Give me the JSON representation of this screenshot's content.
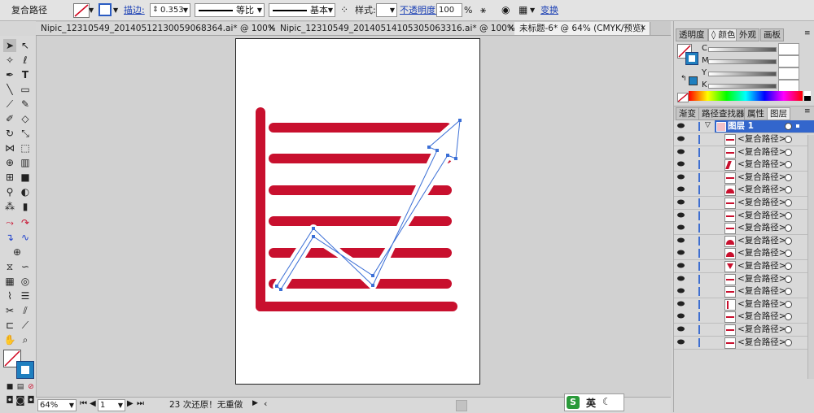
{
  "control_bar": {
    "selection_label": "复合路径",
    "stroke_label": "描边:",
    "stroke_value": "0.353",
    "profile_label": "等比",
    "brush_label": "基本",
    "style_label": "样式:",
    "opacity_label": "不透明度:",
    "opacity_value": "100",
    "opacity_unit": "%",
    "transform_label": "变换"
  },
  "tabs": [
    {
      "label": "Nipic_12310549_20140512130059068364.ai* @ 100% (R...",
      "close": "×"
    },
    {
      "label": "Nipic_12310549_20140514105305063316.ai* @ 100% (R...",
      "close": "×"
    },
    {
      "label": "未标题-6* @ 64% (CMYK/预览)",
      "close": "×"
    }
  ],
  "status_bar": {
    "zoom": "64%",
    "artboard": "1",
    "history": "23 次还原！无重做"
  },
  "ime": {
    "label": "英"
  },
  "color_panel": {
    "tabs": [
      "透明度",
      "颜色",
      "外观",
      "画板"
    ],
    "channels": [
      "C",
      "M",
      "Y",
      "K"
    ]
  },
  "layers_panel": {
    "tabs": [
      "渐变",
      "路径查找器",
      "属性",
      "图层"
    ],
    "layer_name": "图层 1",
    "item_label": "<复合路径>",
    "item_count": 17
  },
  "colors": {
    "accent_red": "#c8102e",
    "selection_blue": "#3b6fd6",
    "layer_highlight": "#3366cc"
  }
}
